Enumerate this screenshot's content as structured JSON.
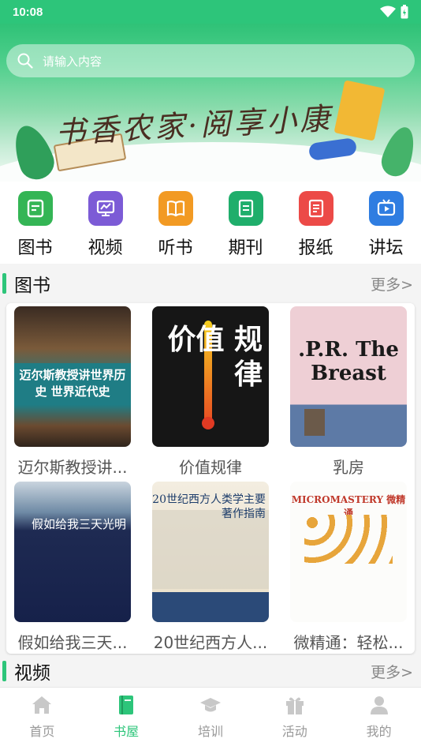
{
  "status_bar": {
    "time": "10:08"
  },
  "search": {
    "placeholder": "请输入内容"
  },
  "banner": {
    "title": "书香农家·阅享小康"
  },
  "categories": [
    {
      "label": "图书",
      "icon": "book-icon",
      "color": "#34b555"
    },
    {
      "label": "视频",
      "icon": "video-icon",
      "color": "#7c5bd6"
    },
    {
      "label": "听书",
      "icon": "audiobook-icon",
      "color": "#f29a23"
    },
    {
      "label": "期刊",
      "icon": "journal-icon",
      "color": "#1fae6b"
    },
    {
      "label": "报纸",
      "icon": "newspaper-icon",
      "color": "#ec4a47"
    },
    {
      "label": "讲坛",
      "icon": "lecture-tv-icon",
      "color": "#2f7de1"
    }
  ],
  "sections": {
    "books": {
      "title": "图书",
      "more": "更多>"
    },
    "videos": {
      "title": "视频",
      "more": "更多>"
    }
  },
  "books": [
    {
      "title": "迈尔斯教授讲...",
      "cover_text": "迈尔斯教授讲世界历史 世界近代史"
    },
    {
      "title": "价值规律",
      "cover_text": "价值 规律"
    },
    {
      "title": "乳房",
      "cover_text": ".P.R. The Breast"
    },
    {
      "title": "假如给我三天...",
      "cover_text": "假如给我三天光明"
    },
    {
      "title": "20世纪西方人...",
      "cover_text": "20世纪西方人类学主要著作指南"
    },
    {
      "title": "微精通：轻松...",
      "cover_text": "MICROMASTERY 微精通"
    }
  ],
  "tabs": [
    {
      "label": "首页",
      "icon": "home-icon",
      "active": false
    },
    {
      "label": "书屋",
      "icon": "bookshelf-icon",
      "active": true
    },
    {
      "label": "培训",
      "icon": "graduation-cap-icon",
      "active": false
    },
    {
      "label": "活动",
      "icon": "gift-icon",
      "active": false
    },
    {
      "label": "我的",
      "icon": "user-icon",
      "active": false
    }
  ],
  "colors": {
    "accent": "#2dc57a",
    "tab_inactive": "#c8c8c8"
  }
}
